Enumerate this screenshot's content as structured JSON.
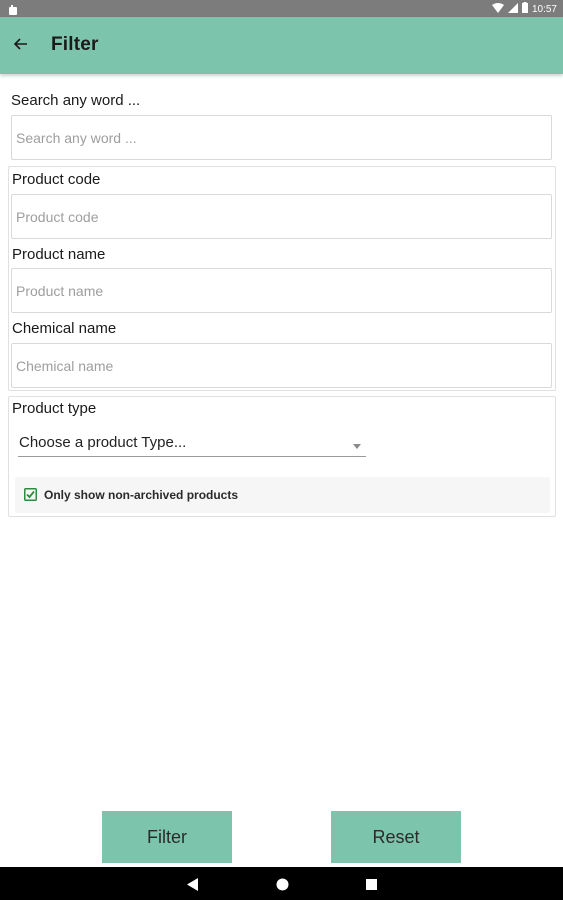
{
  "status_bar": {
    "time": "10:57",
    "icons": [
      "notification-icon",
      "wifi-icon",
      "signal-icon",
      "battery-icon"
    ]
  },
  "app_bar": {
    "title": "Filter",
    "back_icon": "arrow-back-icon",
    "color": "#7cc4ab"
  },
  "search": {
    "label": "Search any word ...",
    "placeholder": "Search any word ...",
    "value": ""
  },
  "product_code": {
    "label": "Product code",
    "placeholder": "Product code",
    "value": ""
  },
  "product_name": {
    "label": "Product name",
    "placeholder": "Product name",
    "value": ""
  },
  "chemical_name": {
    "label": "Chemical name",
    "placeholder": "Chemical name",
    "value": ""
  },
  "product_type": {
    "label": "Product type",
    "selected": "Choose a product Type...",
    "arrow_icon": "dropdown-arrow-icon"
  },
  "archived_checkbox": {
    "label": "Only show non-archived products",
    "checked": true,
    "color": "#2e8b3e"
  },
  "buttons": {
    "filter_label": "Filter",
    "reset_label": "Reset"
  },
  "nav_bar": {
    "icons": [
      "back-triangle-icon",
      "home-circle-icon",
      "recents-square-icon"
    ]
  }
}
